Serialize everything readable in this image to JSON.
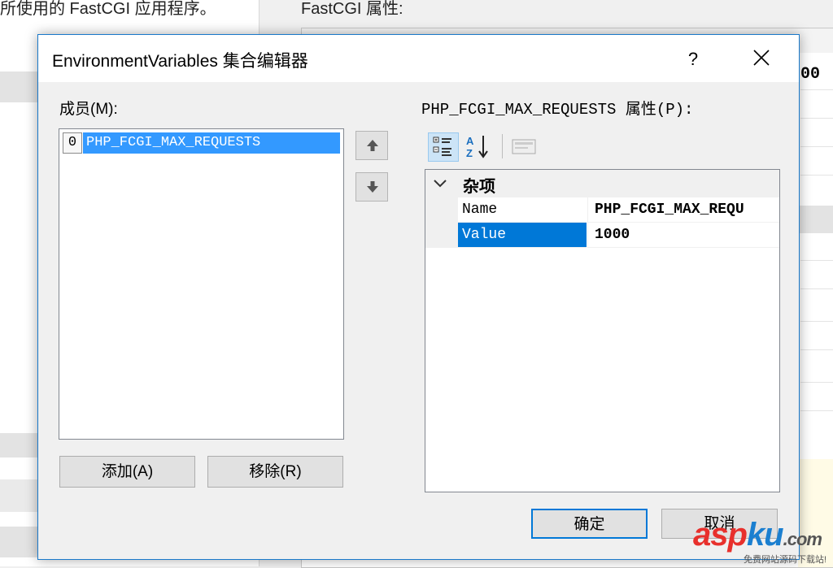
{
  "background": {
    "left_text": "所使用的 FastCGI 应用程序。",
    "right_title": "FastCGI 属性:",
    "right_fragment": "00"
  },
  "dialog": {
    "title": "EnvironmentVariables 集合编辑器",
    "help_label": "?",
    "members_label": "成员(M):",
    "members": [
      {
        "index": "0",
        "name": "PHP_FCGI_MAX_REQUESTS",
        "selected": true
      }
    ],
    "add_label": "添加(A)",
    "remove_label": "移除(R)",
    "properties_label": "PHP_FCGI_MAX_REQUESTS 属性(P):",
    "property_grid": {
      "category": "杂项",
      "rows": [
        {
          "name": "Name",
          "value": "PHP_FCGI_MAX_REQU",
          "selected": false
        },
        {
          "name": "Value",
          "value": "1000",
          "selected": true
        }
      ]
    },
    "ok_label": "确定",
    "cancel_label": "取消"
  },
  "icons": {
    "move_up": "arrow-up-icon",
    "move_down": "arrow-down-icon",
    "categorized": "categorized-view-icon",
    "alphabetical": "sort-az-icon",
    "property_pages": "property-pages-icon",
    "close": "close-icon"
  },
  "watermark": {
    "text_asp": "asp",
    "text_ku": "ku",
    "text_com": ".com",
    "subtitle": "免费网站源码下载站!"
  },
  "colors": {
    "selection": "#3399ff",
    "grid_selection": "#0078d7",
    "dialog_border": "#1979ca",
    "watermark_red": "#e8302c",
    "watermark_blue": "#1b7fd0"
  }
}
